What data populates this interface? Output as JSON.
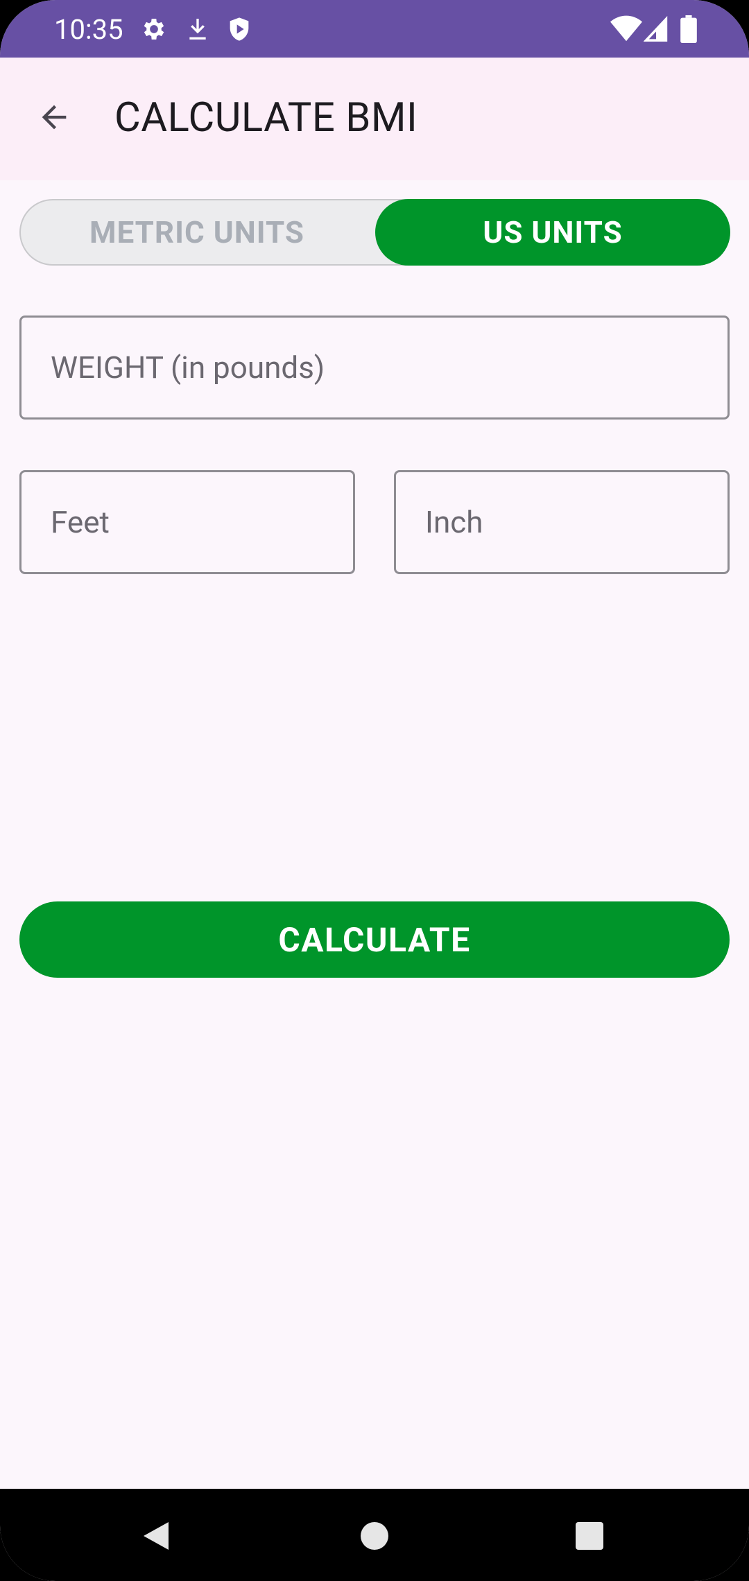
{
  "status_bar": {
    "time": "10:35",
    "left_icons": [
      "settings-icon",
      "download-icon",
      "shield-icon"
    ],
    "right_icons": [
      "wifi-icon",
      "signal-icon",
      "battery-icon"
    ]
  },
  "app_bar": {
    "title": "CALCULATE BMI",
    "back_icon": "arrow-back-icon"
  },
  "unit_toggle": {
    "metric_label": "METRIC UNITS",
    "us_label": "US UNITS",
    "selected": "US UNITS"
  },
  "form": {
    "weight_placeholder": "WEIGHT (in pounds)",
    "weight_value": "",
    "feet_placeholder": "Feet",
    "feet_value": "",
    "inch_placeholder": "Inch",
    "inch_value": ""
  },
  "calculate_label": "CALCULATE",
  "nav_bar": {
    "icons": [
      "nav-back-icon",
      "nav-home-icon",
      "nav-recents-icon"
    ]
  },
  "colors": {
    "status_bar": "#6750A4",
    "app_bar": "#FCEEF8",
    "background": "#FCF6FC",
    "accent_green": "#00952A",
    "toggle_inactive_bg": "#ECECEE",
    "toggle_inactive_text": "#A9AEB6"
  }
}
